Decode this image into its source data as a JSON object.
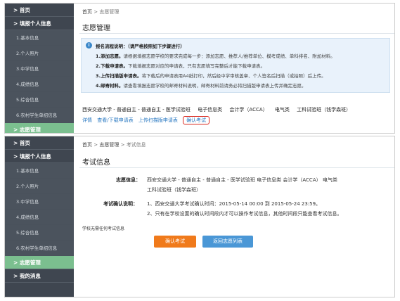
{
  "sidebar": {
    "home": "> 首页",
    "fill_info": "> 填报个人信息",
    "items": [
      "1.基本信息",
      "2.个人照片",
      "3.中学信息",
      "4.成绩信息",
      "5.综合信息",
      "6.农村学生单招信息"
    ],
    "volunteer": "> 志愿管理",
    "messages": "> 我的消息"
  },
  "panel1": {
    "breadcrumb_home": "首页",
    "breadcrumb_sep": ">",
    "breadcrumb_current": "志愿管理",
    "title": "志愿管理",
    "notice_title": "报名流程说明：（请严格按照如下步骤进行）",
    "steps": [
      {
        "bold": "1.添加志愿。",
        "text": "请根据填报志愿学校的要求完成每一步：添加志愿、推荐人/推荐单位、模考成绩、单科排名、附加材料。"
      },
      {
        "bold": "2.下载申请表。",
        "text": "下载填报志愿对应的申请表，只有志愿填写完整后才能下载申请表。"
      },
      {
        "bold": "3.上传扫描版申请表。",
        "text": "将下载后的申请表用A4纸打印，然后经中学审核盖章、个人签名后扫描（或拍照）后上传。"
      },
      {
        "bold": "4.邮寄材料。",
        "text": "请查看填报志愿学校的邮寄材料说明，邮寄材料前请务必将扫描版申请表上传并确定志愿。"
      }
    ],
    "volunteer_row": [
      "西安交通大学 - 普通自主 - 普通自主 - 医学试验班",
      "电子信息类",
      "会计学（ACCA）",
      "电气类",
      "工科试验班（钱学森班）"
    ],
    "links": {
      "detail": "详情",
      "download": "查看/下载申请表",
      "upload": "上传扫描版申请表",
      "confirm": "确认考试"
    }
  },
  "panel2": {
    "breadcrumb_home": "首页",
    "breadcrumb_sep1": ">",
    "breadcrumb_mid": "志愿管理",
    "breadcrumb_sep2": ">",
    "breadcrumb_current": "考试信息",
    "title": "考试信息",
    "volunteer_label": "志愿信息：",
    "volunteer_line1": "西安交通大学 - 普通自主 - 普通自主 - 医学试验班   电子信息类   会计学（ACCA）   电气类",
    "volunteer_line2": "工科试验班（钱学森班）",
    "confirm_label": "考试确认说明：",
    "confirm_line1": "1、西安交通大学考试确认时间：2015-05-14 00:00 到 2015-05-24 23:59。",
    "confirm_line2": "2、只有在学校设置的确认时间段内才可以操作考试信息，其他时间段只能查看考试信息。",
    "note": "学校无需任何考试信息",
    "btn_confirm": "确认考试",
    "btn_back": "返回志愿列表"
  },
  "colors": {
    "sidebar": "#3f4650",
    "active": "#7bbf8f",
    "link": "#2a79c2",
    "highlight": "#d9261c",
    "orange": "#f07a1b",
    "blue": "#4a97d6"
  }
}
